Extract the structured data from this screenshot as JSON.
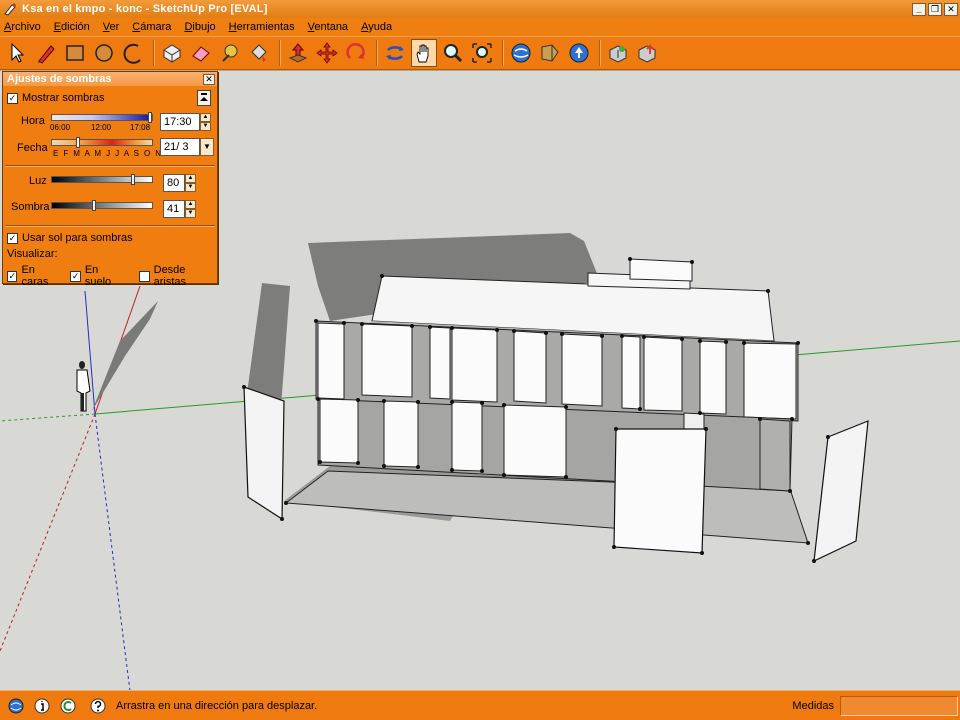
{
  "window": {
    "title": "Ksa en el kmpo - konc - SketchUp Pro [EVAL]",
    "controls": [
      "_",
      "❐",
      "✕"
    ]
  },
  "menu": {
    "items": [
      {
        "label": "Archivo",
        "u": "A",
        "rest": "rchivo"
      },
      {
        "label": "Edición",
        "u": "E",
        "rest": "dición"
      },
      {
        "label": "Ver",
        "u": "V",
        "rest": "er"
      },
      {
        "label": "Cámara",
        "u": "C",
        "rest": "ámara"
      },
      {
        "label": "Dibujo",
        "u": "D",
        "rest": "ibujo"
      },
      {
        "label": "Herramientas",
        "u": "H",
        "rest": "erramientas"
      },
      {
        "label": "Ventana",
        "u": "V",
        "rest": "entana"
      },
      {
        "label": "Ayuda",
        "u": "A",
        "rest": "yuda"
      }
    ]
  },
  "toolbar": {
    "tools": [
      "select-icon",
      "pencil-icon",
      "rectangle-icon",
      "circle-icon",
      "arc-icon",
      "sep",
      "make-component-icon",
      "eraser-icon",
      "tape-measure-icon",
      "paint-bucket-icon",
      "sep",
      "push-pull-icon",
      "move-icon",
      "rotate-icon",
      "sep",
      "orbit-icon",
      "pan-icon",
      "zoom-icon",
      "zoom-extents-icon",
      "sep",
      "3d-warehouse-icon",
      "get-models-icon",
      "share-model-icon",
      "sep",
      "component-icon",
      "share-component-icon"
    ],
    "active_tool": "pan-icon"
  },
  "shadow_panel": {
    "title": "Ajustes de sombras",
    "show_shadows_label": "Mostrar sombras",
    "show_shadows": true,
    "time_label": "Hora",
    "time_value": "17:30",
    "time_ticks": [
      "06:00",
      "12:00",
      "17:08"
    ],
    "date_label": "Fecha",
    "date_value": "21/ 3",
    "months": "E F M A M J J A S O N D",
    "light_label": "Luz",
    "light_value": "80",
    "shade_label": "Sombra",
    "shade_value": "41",
    "use_sun_label": "Usar sol para sombras",
    "use_sun": true,
    "display_label": "Visualizar:",
    "on_faces_label": "En caras",
    "on_faces": true,
    "on_ground_label": "En suelo",
    "on_ground": true,
    "from_edges_label": "Desde aristas",
    "from_edges": false
  },
  "status": {
    "message": "Arrastra en una dirección para desplazar.",
    "measure_label": "Medidas",
    "measure_value": ""
  },
  "colors": {
    "accent": "#ee7a10",
    "title_bar": "#e88820",
    "viewport_bg": "#d8d8d4"
  }
}
